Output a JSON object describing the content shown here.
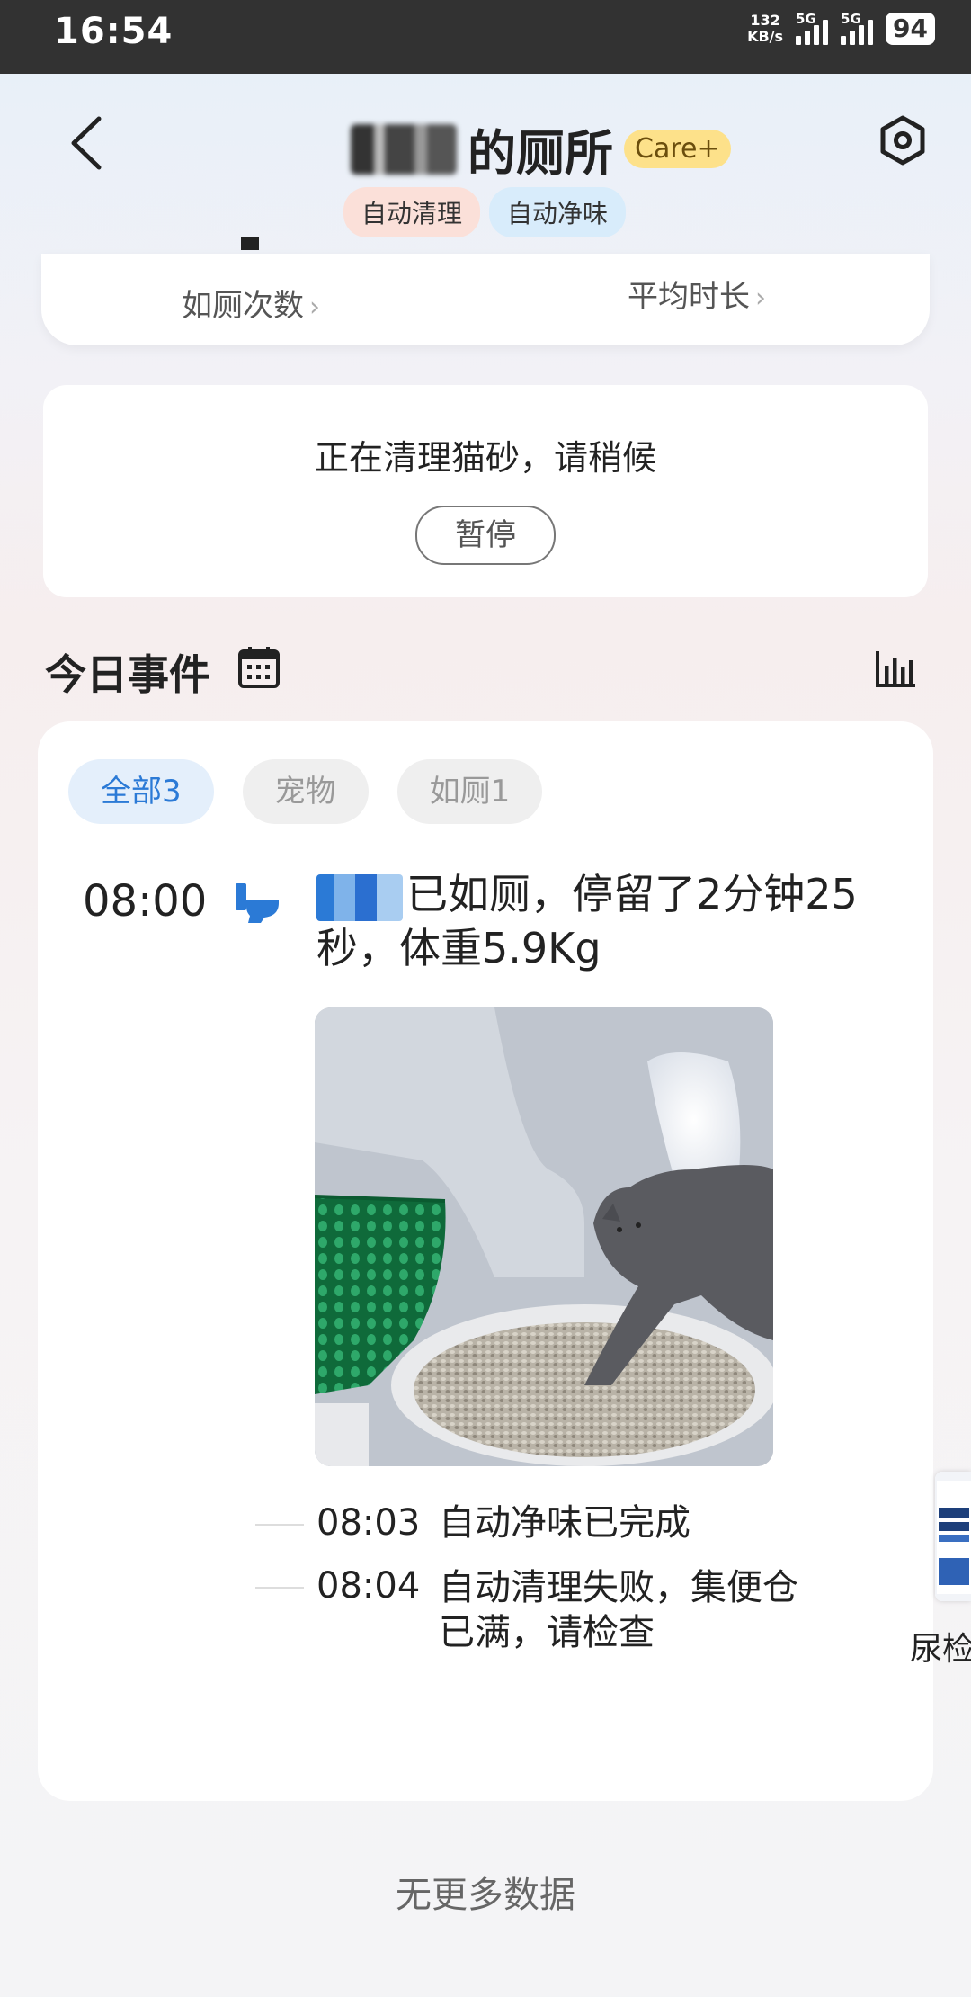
{
  "status_bar": {
    "time": "16:54",
    "net_speed_value": "132",
    "net_speed_unit": "KB/s",
    "sim1_label": "5G",
    "sim2_label": "5G",
    "battery": "94"
  },
  "header": {
    "title_suffix": "的厕所",
    "care_badge": "Care+",
    "chips": [
      "自动清理",
      "自动净味"
    ]
  },
  "stats": {
    "visits_label": "如厕次数",
    "avg_duration_label": "平均时长",
    "chevron": "›"
  },
  "clean_card": {
    "message": "正在清理猫砂，请稍候",
    "pause_button": "暂停"
  },
  "events": {
    "section_title": "今日事件",
    "tabs": [
      "全部3",
      "宠物",
      "如厕1"
    ],
    "main_event": {
      "time": "08:00",
      "text": "已如厕，停留了2分钟25秒，体重5.9Kg"
    },
    "sub_events": [
      {
        "time": "08:03",
        "text": "自动净味已完成"
      },
      {
        "time": "08:04",
        "text": "自动清理失败，集便仓已满，请检查"
      }
    ],
    "no_more": "无更多数据"
  },
  "side_widget": {
    "label": "尿检"
  },
  "colors": {
    "accent_blue": "#2b7ad6",
    "care_badge_bg": "#fde18a",
    "chip_red_bg": "#fbe0d9",
    "chip_blue_bg": "#d8ecfb"
  }
}
